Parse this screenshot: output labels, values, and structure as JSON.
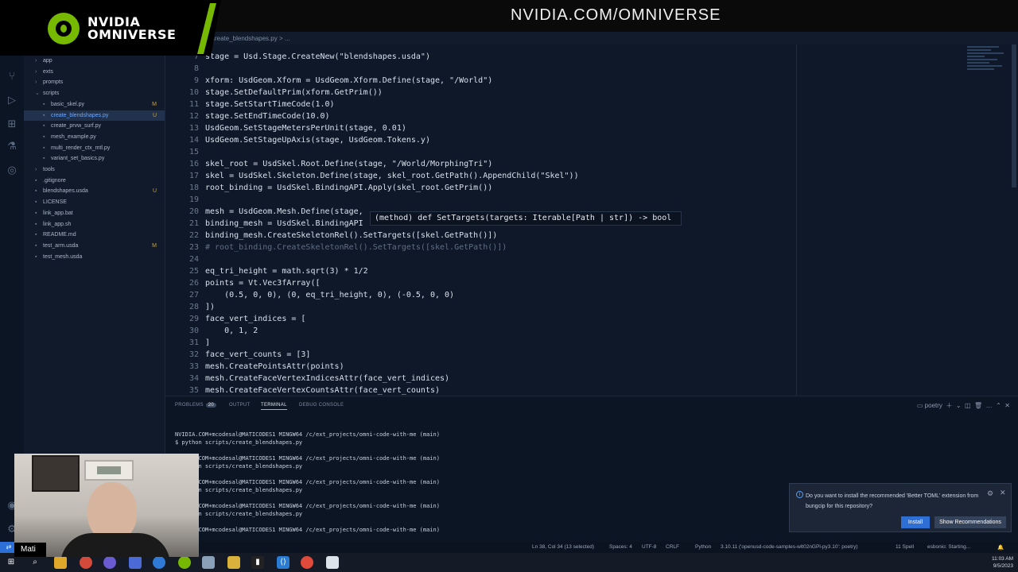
{
  "banner": {
    "logo_line1": "NVIDIA",
    "logo_line2": "OMNIVERSE",
    "url": "NVIDIA.COM/OMNIVERSE",
    "brand_color": "#76b900"
  },
  "editor": {
    "breadcrumb": "create_blendshapes.py > ...",
    "hover_tooltip": "(method) def SetTargets(targets: Iterable[Path | str]) -> bool",
    "lines": [
      {
        "n": "7",
        "code": "stage = Usd.Stage.CreateNew(\"blendshapes.usda\")"
      },
      {
        "n": "8",
        "code": ""
      },
      {
        "n": "9",
        "code": "xform: UsdGeom.Xform = UsdGeom.Xform.Define(stage, \"/World\")"
      },
      {
        "n": "10",
        "code": "stage.SetDefaultPrim(xform.GetPrim())"
      },
      {
        "n": "11",
        "code": "stage.SetStartTimeCode(1.0)"
      },
      {
        "n": "12",
        "code": "stage.SetEndTimeCode(10.0)"
      },
      {
        "n": "13",
        "code": "UsdGeom.SetStageMetersPerUnit(stage, 0.01)"
      },
      {
        "n": "14",
        "code": "UsdGeom.SetStageUpAxis(stage, UsdGeom.Tokens.y)"
      },
      {
        "n": "15",
        "code": ""
      },
      {
        "n": "16",
        "code": "skel_root = UsdSkel.Root.Define(stage, \"/World/MorphingTri\")"
      },
      {
        "n": "17",
        "code": "skel = UsdSkel.Skeleton.Define(stage, skel_root.GetPath().AppendChild(\"Skel\"))"
      },
      {
        "n": "18",
        "code": "root_binding = UsdSkel.BindingAPI.Apply(skel_root.GetPrim())"
      },
      {
        "n": "19",
        "code": ""
      },
      {
        "n": "20",
        "code": "mesh = UsdGeom.Mesh.Define(stage,"
      },
      {
        "n": "21",
        "code": "binding_mesh = UsdSkel.BindingAPI"
      },
      {
        "n": "22",
        "code": "binding_mesh.CreateSkeletonRel().SetTargets([skel.GetPath()])"
      },
      {
        "n": "23",
        "code": "# root_binding.CreateSkeletonRel().SetTargets([skel.GetPath()])",
        "comment": true
      },
      {
        "n": "24",
        "code": ""
      },
      {
        "n": "25",
        "code": "eq_tri_height = math.sqrt(3) * 1/2"
      },
      {
        "n": "26",
        "code": "points = Vt.Vec3fArray(["
      },
      {
        "n": "27",
        "code": "    (0.5, 0, 0), (0, eq_tri_height, 0), (-0.5, 0, 0)"
      },
      {
        "n": "28",
        "code": "])"
      },
      {
        "n": "29",
        "code": "face_vert_indices = ["
      },
      {
        "n": "30",
        "code": "    0, 1, 2"
      },
      {
        "n": "31",
        "code": "]"
      },
      {
        "n": "32",
        "code": "face_vert_counts = [3]"
      },
      {
        "n": "33",
        "code": "mesh.CreatePointsAttr(points)"
      },
      {
        "n": "34",
        "code": "mesh.CreateFaceVertexIndicesAttr(face_vert_indices)"
      },
      {
        "n": "35",
        "code": "mesh.CreateFaceVertexCountsAttr(face_vert_counts)"
      }
    ]
  },
  "sidebar": {
    "items": [
      {
        "label": "app",
        "indent": 1,
        "folder": true
      },
      {
        "label": "exts",
        "indent": 1,
        "folder": true
      },
      {
        "label": "prompts",
        "indent": 1,
        "folder": true
      },
      {
        "label": "scripts",
        "indent": 1,
        "folder": true,
        "open": true
      },
      {
        "label": "basic_skel.py",
        "indent": 2,
        "badge": "M"
      },
      {
        "label": "create_blendshapes.py",
        "indent": 2,
        "badge": "U",
        "selected": true
      },
      {
        "label": "create_prvw_surf.py",
        "indent": 2
      },
      {
        "label": "mesh_example.py",
        "indent": 2
      },
      {
        "label": "multi_render_ctx_mtl.py",
        "indent": 2
      },
      {
        "label": "variant_set_basics.py",
        "indent": 2
      },
      {
        "label": "tools",
        "indent": 1,
        "folder": true
      },
      {
        "label": ".gitignore",
        "indent": 1
      },
      {
        "label": "blendshapes.usda",
        "indent": 1,
        "badge": "U"
      },
      {
        "label": "LICENSE",
        "indent": 1
      },
      {
        "label": "link_app.bat",
        "indent": 1
      },
      {
        "label": "link_app.sh",
        "indent": 1
      },
      {
        "label": "README.md",
        "indent": 1
      },
      {
        "label": "test_arm.usda",
        "indent": 1,
        "badge": "M"
      },
      {
        "label": "test_mesh.usda",
        "indent": 1
      }
    ]
  },
  "panel": {
    "tabs": [
      {
        "label": "PROBLEMS",
        "count": "20"
      },
      {
        "label": "OUTPUT"
      },
      {
        "label": "TERMINAL",
        "active": true
      },
      {
        "label": "DEBUG CONSOLE"
      }
    ],
    "shell_name": "poetry",
    "terminal": [
      {
        "prompt": "NVIDIA.COM+mcodesal@MATICODES1 MINGW64 /c/ext_projects/omni-code-with-me (main)",
        "cmd": "$ python scripts/create_blendshapes.py"
      },
      {
        "prompt": "NVIDIA.COM+mcodesal@MATICODES1 MINGW64 /c/ext_projects/omni-code-with-me (main)",
        "cmd": "$ python scripts/create_blendshapes.py"
      },
      {
        "prompt": "NVIDIA.COM+mcodesal@MATICODES1 MINGW64 /c/ext_projects/omni-code-with-me (main)",
        "cmd": "$ python scripts/create_blendshapes.py"
      },
      {
        "prompt": "NVIDIA.COM+mcodesal@MATICODES1 MINGW64 /c/ext_projects/omni-code-with-me (main)",
        "cmd": "$ python scripts/create_blendshapes.py"
      },
      {
        "prompt": "NVIDIA.COM+mcodesal@MATICODES1 MINGW64 /c/ext_projects/omni-code-with-me (main)",
        "cmd": ""
      }
    ]
  },
  "webcam": {
    "name": "Mati"
  },
  "notification": {
    "message": "Do you want to install the recommended 'Better TOML' extension from bungcip for this repository?",
    "install_label": "Install",
    "show_label": "Show Recommendations"
  },
  "statusbar": {
    "position": "Ln 38, Col 34 (13 selected)",
    "spaces": "Spaces: 4",
    "encoding": "UTF-8",
    "eol": "CRLF",
    "language": "Python",
    "interpreter": "3.10.11 ('openusd-code-samples-wlt02nGPl-py3.10': poetry)",
    "spell": "11 Spell",
    "esbonio": "esbonio: Starting..."
  },
  "taskbar": {
    "time": "11:03 AM",
    "date": "9/5/2023"
  }
}
